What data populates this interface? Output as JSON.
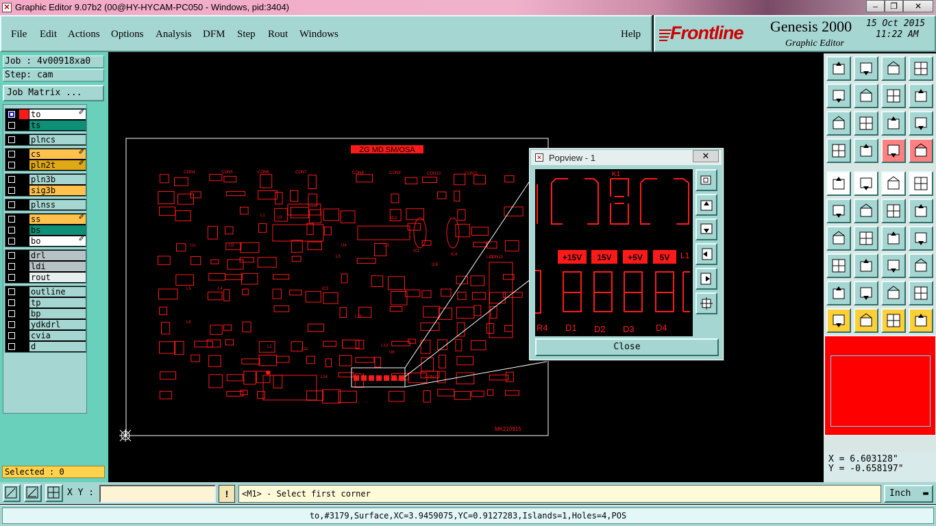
{
  "window": {
    "title": "Graphic Editor 9.07b2 (00@HY-HYCAM-PC050 - Windows, pid:3404)",
    "minimize": "–",
    "maximize": "❐",
    "close": "✕"
  },
  "menu": {
    "items": [
      "File",
      "Edit",
      "Actions",
      "Options",
      "Analysis",
      "DFM",
      "Step",
      "Rout",
      "Windows"
    ],
    "help": "Help"
  },
  "brand": {
    "logo": "Frontline",
    "product": "Genesis 2000",
    "subtitle": "Graphic Editor",
    "date": "15 Oct 2015",
    "time": "11:22 AM"
  },
  "job": {
    "job_label": "Job : 4v00918xa0",
    "step_label": "Step: cam",
    "matrix_button": "Job Matrix ..."
  },
  "layers": [
    {
      "name": "to",
      "color": "#ffffff",
      "checked": true,
      "shown": true,
      "editable": true
    },
    {
      "name": "ts",
      "color": "#0e8f78",
      "checked": false,
      "shown": false,
      "editable": false
    },
    {
      "name": "plncs",
      "color": "#a6d6d2",
      "checked": false,
      "shown": false,
      "editable": false
    },
    {
      "name": "cs",
      "color": "#ffc04c",
      "checked": false,
      "shown": false,
      "editable": true
    },
    {
      "name": "pln2t",
      "color": "#e0a818",
      "checked": false,
      "shown": false,
      "editable": true
    },
    {
      "name": "pln3b",
      "color": "#a6d6d2",
      "checked": false,
      "shown": false,
      "editable": false
    },
    {
      "name": "sig3b",
      "color": "#ffc04c",
      "checked": false,
      "shown": false,
      "editable": false
    },
    {
      "name": "plnss",
      "color": "#a6d6d2",
      "checked": false,
      "shown": false,
      "editable": false
    },
    {
      "name": "ss",
      "color": "#ffc04c",
      "checked": false,
      "shown": false,
      "editable": true
    },
    {
      "name": "bs",
      "color": "#0e8f78",
      "checked": false,
      "shown": false,
      "editable": false
    },
    {
      "name": "bo",
      "color": "#ffffff",
      "checked": false,
      "shown": false,
      "editable": true
    },
    {
      "name": "drl",
      "color": "#b6c2c6",
      "checked": false,
      "shown": false,
      "editable": false
    },
    {
      "name": "ldi",
      "color": "#b6c2c6",
      "checked": false,
      "shown": false,
      "editable": false
    },
    {
      "name": "rout",
      "color": "#e6eeee",
      "checked": false,
      "shown": false,
      "editable": false
    },
    {
      "name": "outline",
      "color": "#a6d6d2",
      "checked": false,
      "shown": false,
      "editable": false
    },
    {
      "name": "tp",
      "color": "#a6d6d2",
      "checked": false,
      "shown": false,
      "editable": false
    },
    {
      "name": "bp",
      "color": "#a6d6d2",
      "checked": false,
      "shown": false,
      "editable": false
    },
    {
      "name": "ydkdrl",
      "color": "#a6d6d2",
      "checked": false,
      "shown": false,
      "editable": false
    },
    {
      "name": "cvia",
      "color": "#a6d6d2",
      "checked": false,
      "shown": false,
      "editable": false
    },
    {
      "name": "d",
      "color": "#a6d6d2",
      "checked": false,
      "shown": false,
      "editable": false
    }
  ],
  "selected_label": "Selected : 0",
  "board": {
    "title": "ZG MD SM/OSA",
    "code": "MK210915",
    "labels": [
      "CON4",
      "CON5",
      "CON6",
      "CON7",
      "CON8",
      "CON9",
      "CON10",
      "CON11",
      "U1",
      "U2",
      "U3",
      "U4",
      "U5",
      "IC1",
      "IC2",
      "IC3",
      "IC4",
      "IC6",
      "L1",
      "L2",
      "L3",
      "L4",
      "L5",
      "L6",
      "L11",
      "L12",
      "L13",
      "CON13",
      "U6",
      "CON12",
      "L24",
      "L25"
    ]
  },
  "popview": {
    "title": "Popview - 1",
    "close_x": "✕",
    "close_button": "Close",
    "labels": [
      "+15V",
      "15V",
      "+5V",
      "5V"
    ],
    "bottom_labels": [
      "R4",
      "D1",
      "D2",
      "D3",
      "D4"
    ],
    "top_label": "K1",
    "side_label": "L1"
  },
  "coords": {
    "x": "X = 6.603128\"",
    "y": "Y = -0.658197\""
  },
  "cmd": {
    "xy_label": "X Y :",
    "xy_value": "",
    "excl": "!",
    "prompt": "<M1> - Select first corner",
    "units": "Inch"
  },
  "status": "to,#3179,Surface,XC=3.9459075,YC=0.9127283,Islands=1,Holes=4,POS",
  "colors": {
    "panel": "#a6d6d2",
    "board": "#ff1a1a",
    "canvas": "#000000"
  },
  "icons": {
    "toolbar": [
      "fit-icon",
      "zoom-home-icon",
      "home-icon",
      "window-icon",
      "pan-left-icon",
      "pan-right-icon",
      "undo-zoom-icon",
      "redo-zoom-icon",
      "zoom-fit-icon",
      "zoom-center-icon",
      "scale-1-2-icon",
      "help-icon",
      "tools-icon",
      "probe-icon",
      "netlist-icon",
      "netlist2-icon",
      "camera-icon",
      "shape-icon",
      "ruler-icon",
      "dot-icon",
      "connect-icon",
      "snap-icon",
      "measure-icon",
      "arrow-icon",
      "line-icon",
      "line-red-icon",
      "arc-icon",
      "cross-icon",
      "move-icon",
      "minus-icon",
      "grid-icon",
      "group-icon",
      "triangle-icon",
      "triangle-up-icon",
      "a-icon",
      "a-cross-icon",
      "select-icon",
      "select2-icon",
      "rotate-icon",
      "route-icon"
    ]
  }
}
